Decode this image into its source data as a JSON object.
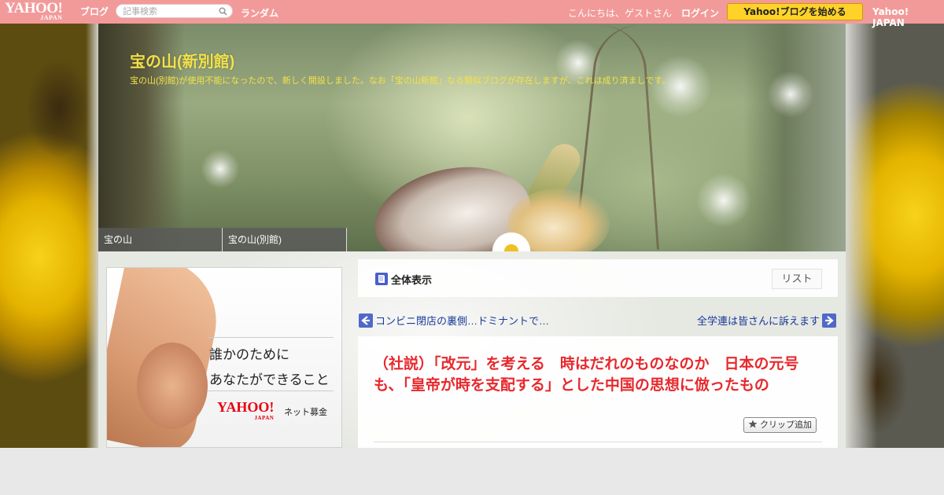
{
  "topbar": {
    "logo": "YAHOO!",
    "logo_sub": "JAPAN",
    "blog_label": "ブログ",
    "search_placeholder": "記事検索",
    "random": "ランダム",
    "greeting": "こんにちは、ゲストさん",
    "login": "ログイン",
    "start_blog": "Yahoo!ブログを始める",
    "yahoo_japan": "Yahoo! JAPAN",
    "color": "#f29a9a"
  },
  "header": {
    "title": "宝の山(新別館)",
    "subtitle": "宝の山(別館)が使用不能になったので、新しく開設しました。なお「宝の山新館」なる類似ブログが存在しますが、これは成り済ましです。",
    "title_color": "#f3e14a"
  },
  "nav": {
    "items": [
      {
        "label": "宝の山"
      },
      {
        "label": "宝の山(別館)"
      }
    ]
  },
  "ad": {
    "line1": "誰かのために",
    "line2": "あなたができること",
    "logo": "YAHOO!",
    "logo_sub": "JAPAN",
    "service": "ネット募金"
  },
  "section": {
    "all_label": "全体表示",
    "list_button": "リスト"
  },
  "navigation": {
    "prev": "コンビニ閉店の裏側…ドミナントで…",
    "next": "全学連は皆さんに訴えます"
  },
  "article": {
    "title": "（社説）「改元」を考える　時はだれのものなのか　日本の元号も、「皇帝が時を支配する」とした中国の思想に倣ったもの",
    "clip_button": "クリップ追加",
    "title_color": "#e8282d"
  }
}
